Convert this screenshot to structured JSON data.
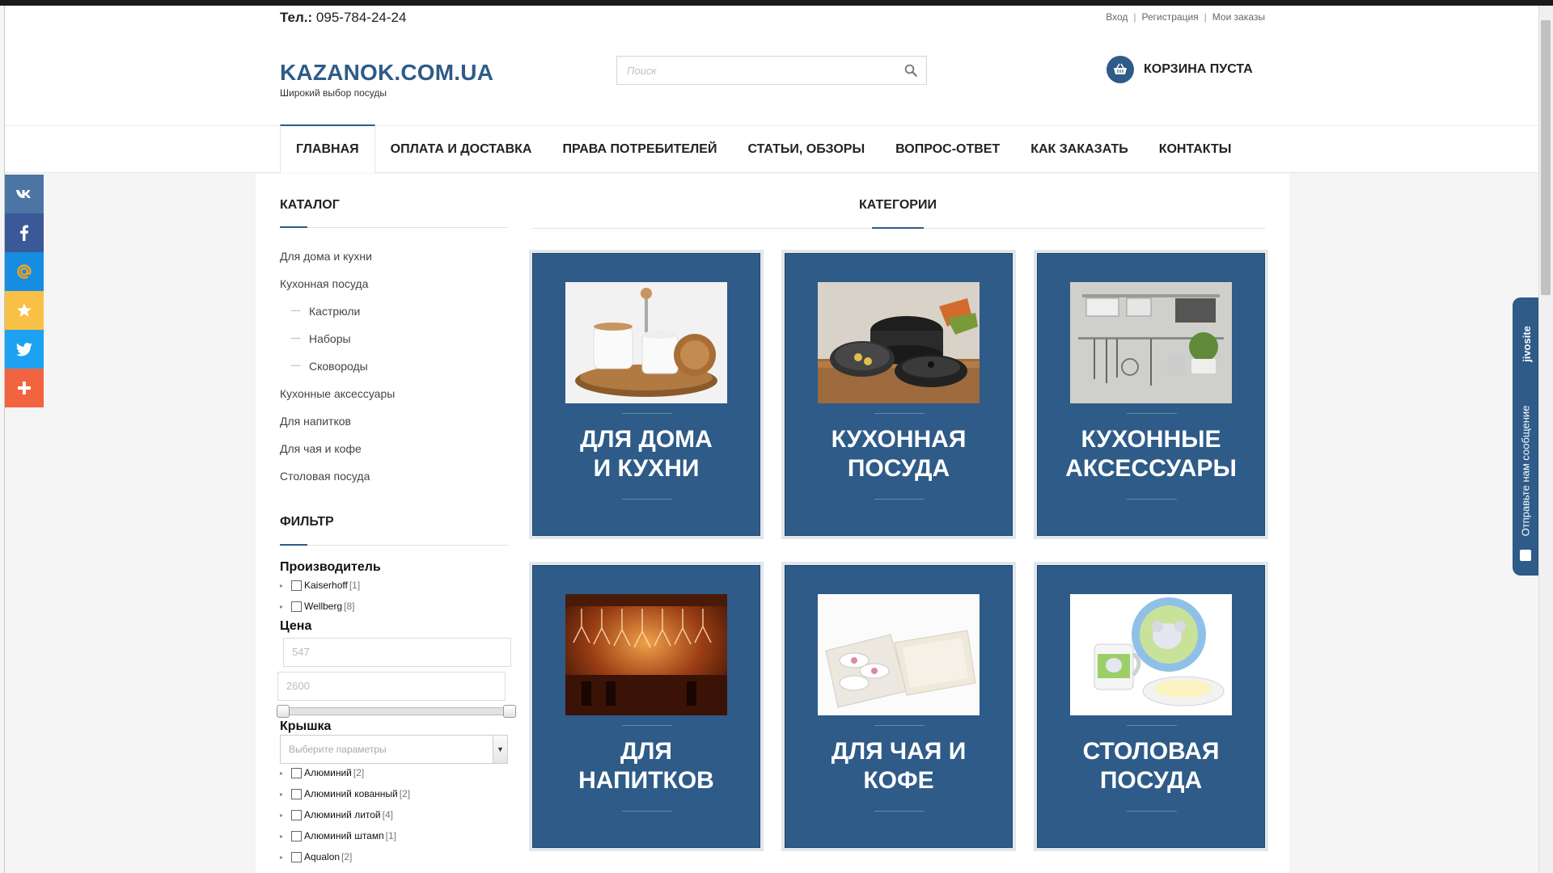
{
  "header": {
    "phone_label": "Тел.:",
    "phone_number": "095-784-24-24",
    "links": {
      "login": "Вход",
      "register": "Регистрация",
      "orders": "Мои заказы",
      "separator": "|"
    },
    "logo": "KAZANOK.COM.UA",
    "slogan": "Широкий выбор посуды",
    "search_placeholder": "Поиск",
    "cart_label": "КОРЗИНА ПУСТА"
  },
  "nav": [
    {
      "label": "ГЛАВНАЯ",
      "active": true
    },
    {
      "label": "ОПЛАТА И ДОСТАВКА"
    },
    {
      "label": "ПРАВА ПОТРЕБИТЕЛЕЙ"
    },
    {
      "label": "СТАТЬИ, ОБЗОРЫ"
    },
    {
      "label": "ВОПРОС-ОТВЕТ"
    },
    {
      "label": "КАК ЗАКАЗАТЬ"
    },
    {
      "label": "КОНТАКТЫ"
    }
  ],
  "sidebar": {
    "catalog_title": "КАТАЛОГ",
    "catalog": [
      {
        "label": "Для дома и кухни"
      },
      {
        "label": "Кухонная посуда"
      },
      {
        "label": "Кастрюли",
        "sub": true
      },
      {
        "label": "Наборы",
        "sub": true
      },
      {
        "label": "Сковороды",
        "sub": true
      },
      {
        "label": "Кухонные аксессуары"
      },
      {
        "label": "Для напитков"
      },
      {
        "label": "Для чая и кофе"
      },
      {
        "label": "Столовая посуда"
      }
    ],
    "filter_title": "ФИЛЬТР",
    "manufacturer_label": "Производитель",
    "manufacturers": [
      {
        "name": "Kaiserhoff",
        "count": "[1]"
      },
      {
        "name": "Wellberg",
        "count": "[8]"
      }
    ],
    "price_label": "Цена",
    "price_min": "547",
    "price_max": "2600",
    "lid_label": "Крышка",
    "lid_select_placeholder": "Выберите параметры",
    "lid_options": [
      {
        "name": "Алюминий",
        "count": "[2]"
      },
      {
        "name": "Алюминий кованный",
        "count": "[2]"
      },
      {
        "name": "Алюминий литой",
        "count": "[4]"
      },
      {
        "name": "Алюминий штамп",
        "count": "[1]"
      },
      {
        "name": "Aqualon",
        "count": "[2]"
      }
    ]
  },
  "main": {
    "heading": "КАТЕГОРИИ",
    "categories": [
      {
        "label": "ДЛЯ ДОМА\nИ КУХНИ",
        "image": "tea-set-on-wooden-tray"
      },
      {
        "label": "КУХОННАЯ\nПОСУДА",
        "image": "black-pots-and-pans"
      },
      {
        "label": "КУХОННЫЕ\nАКСЕССУАРЫ",
        "image": "kitchen-rail-with-utensils"
      },
      {
        "label": "ДЛЯ\nНАПИТКОВ",
        "image": "hanging-wine-glasses-bar"
      },
      {
        "label": "ДЛЯ ЧАЯ И\nКОФЕ",
        "image": "tea-cups-gift-box"
      },
      {
        "label": "СТОЛОВАЯ\nПОСУДА",
        "image": "kids-dinnerware-set"
      }
    ]
  },
  "chat_widget": {
    "brand": "jivosite",
    "prompt": "Отправьте нам сообщение"
  },
  "social": [
    "vk-icon",
    "facebook-icon",
    "mail-icon",
    "star-icon",
    "twitter-icon",
    "plus-icon"
  ],
  "colors": {
    "brand_blue": "#2e5b88",
    "vk": "#4c75a3",
    "facebook": "#3b5998",
    "mail": "#168de2",
    "favorite": "#f8c045",
    "twitter": "#1da1f2",
    "share": "#f26440"
  }
}
